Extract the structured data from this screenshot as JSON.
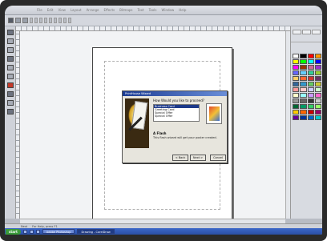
{
  "menubar": {
    "items": [
      "File",
      "Edit",
      "View",
      "Layout",
      "Arrange",
      "Effects",
      "Bitmaps",
      "Text",
      "Tools",
      "Window",
      "Help"
    ]
  },
  "wizard": {
    "title": "PrintHouse Wizard",
    "heading": "How Would you like to proceed?",
    "options": [
      "Business Card",
      "Greeting Card",
      "Special Offer",
      "Special Offer"
    ],
    "description_title": "A Flash",
    "description": "This flash wizard will get your poster created.",
    "buttons": {
      "back": "< Back",
      "next": "Next >",
      "cancel": "Cancel"
    }
  },
  "statusbar": {
    "left": "Next",
    "right": "For Help, press F1"
  },
  "taskbar": {
    "start": "start",
    "tasks": [
      "Adobe Photoshop",
      "Untitled - Corel Draw"
    ],
    "active_task": "Drawing - CorelDraw"
  },
  "colors": {
    "title_gradient": "#1c3c94",
    "taskbar": "#2a4fa6",
    "palette": [
      "#ffffff",
      "#000000",
      "#ff0000",
      "#ff9900",
      "#ffff00",
      "#00ff00",
      "#00ffff",
      "#0000ff",
      "#ff00ff",
      "#993300",
      "#cc6699",
      "#9933cc",
      "#6666ff",
      "#66ccff",
      "#33cc99",
      "#99cc33",
      "#ffcc66",
      "#ff6633",
      "#cc3333",
      "#663366",
      "#336699",
      "#3399cc",
      "#66cc66",
      "#cccc33",
      "#ff9999",
      "#ffcccc",
      "#ccccff",
      "#ccffcc",
      "#ffffcc",
      "#99ffff",
      "#cc99ff",
      "#ff66cc",
      "#999999",
      "#666666",
      "#333333",
      "#cccccc",
      "#006633",
      "#009966",
      "#33cc66",
      "#99ff66",
      "#ffcc00",
      "#ff6600",
      "#cc0000",
      "#990066",
      "#660099",
      "#003399",
      "#0066cc",
      "#00cccc"
    ]
  }
}
